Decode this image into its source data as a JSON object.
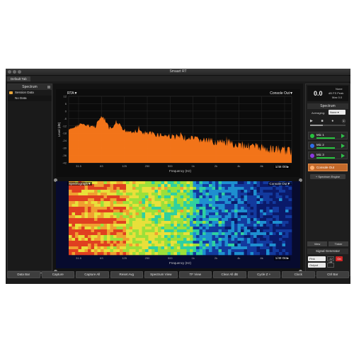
{
  "window": {
    "title": "Smaart RT",
    "tab": "Default Tab"
  },
  "left_panel": {
    "header": "Spectrum",
    "items": [
      "Session Data",
      "No Data"
    ]
  },
  "rta": {
    "label": "RTA▼",
    "source": "Console Out▼",
    "source_tag": "1/48 Oct▸",
    "ylabel": "Level (dB)",
    "xlabel": "Frequency (Hz)",
    "yticks": [
      "12",
      "6",
      "0",
      "-6",
      "-12",
      "-18",
      "-24",
      "-30",
      "-36",
      "-42"
    ],
    "xticks": [
      "31.5",
      "63",
      "125",
      "250",
      "500",
      "1k",
      "2k",
      "4k",
      "8k",
      "16k"
    ],
    "color": "#ff7a1a"
  },
  "spectrograph": {
    "label": "Spectrograph▼",
    "source": "Console Out▼",
    "source_tag": "1/48 Oct▸",
    "xlabel": "Frequency (Hz)",
    "xticks": [
      "31.5",
      "63",
      "125",
      "250",
      "500",
      "1k",
      "2k",
      "4k",
      "8k",
      "16k"
    ]
  },
  "right_panel": {
    "meter_value": "0.0",
    "meter_lines": [
      "None",
      "dB FS Peak",
      "Max 0.0"
    ],
    "spectrum_header": "Spectrum",
    "averaging_label": "Averaging:",
    "averaging_value": "None",
    "transport": [
      "▶",
      "■",
      "●",
      "⦿"
    ],
    "mics": [
      {
        "label": "Mic 1",
        "color": "#27c23e"
      },
      {
        "label": "Mic 2",
        "color": "#2f6ee8"
      },
      {
        "label": "Mic 3",
        "color": "#8a3ae0"
      }
    ],
    "console": {
      "label": "Console Out",
      "color": "#f07d24"
    },
    "engine_button": "+ Spectrum Engine",
    "view_buttons": [
      "View",
      "Tinker"
    ],
    "signal_generator": {
      "header": "Signal Generator",
      "source": "Pink",
      "level": "-12 dB",
      "on": "On",
      "output": "Output"
    }
  },
  "bottom_buttons": [
    "Data Bar",
    "Capture",
    "Capture All",
    "Reset Avg",
    "Spectrum View",
    "TF View",
    "Clear All dB",
    "Cycle Z +",
    "Clock",
    "Ctrl Bar"
  ]
}
